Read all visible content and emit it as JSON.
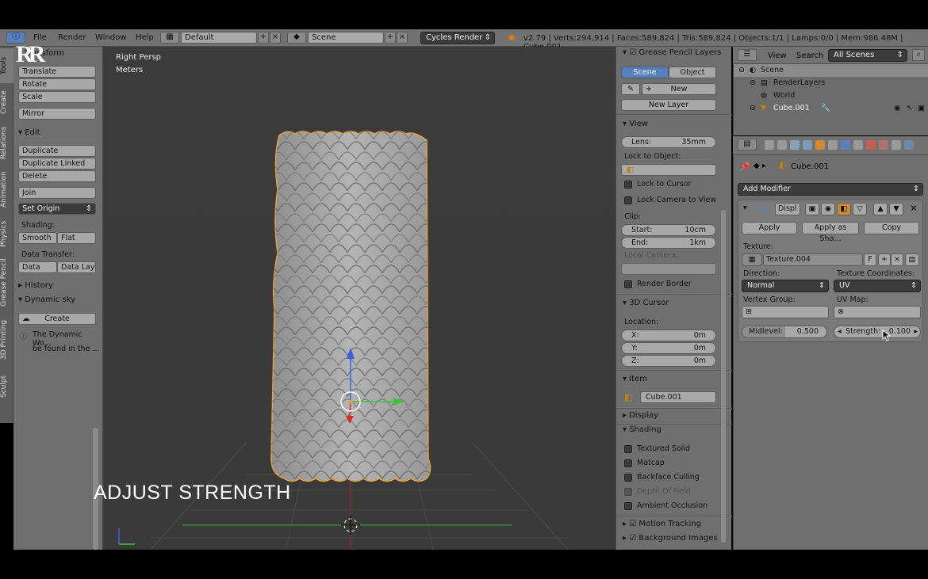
{
  "header": {
    "menus": [
      "File",
      "Render",
      "Window",
      "Help"
    ],
    "layout_name": "Default",
    "scene_name": "Scene",
    "render_engine": "Cycles Render",
    "stats": "v2.79 | Verts:294,914 | Faces:589,824 | Tris:589,824 | Objects:1/1 | Lamps:0/0 | Mem:986.48M | Cube.001"
  },
  "vtabs": [
    "Tools",
    "Create",
    "Relations",
    "Animation",
    "Physics",
    "Grease Pencil",
    "3D Printing",
    "Sculpt"
  ],
  "toolshelf": {
    "transform": {
      "title": "Transform",
      "buttons": [
        "Translate",
        "Rotate",
        "Scale",
        "Mirror"
      ]
    },
    "edit": {
      "title": "Edit",
      "buttons": [
        "Duplicate",
        "Duplicate Linked",
        "Delete",
        "Join"
      ],
      "set_origin": "Set Origin",
      "shading_label": "Shading:",
      "smooth": "Smooth",
      "flat": "Flat",
      "data_transfer_label": "Data Transfer:",
      "data": "Data",
      "data_lay": "Data Lay"
    },
    "history": "History",
    "dynamic_sky": {
      "title": "Dynamic sky",
      "create": "Create",
      "info1": "The Dynamic Wo...",
      "info2": "be found in the ..."
    }
  },
  "viewport": {
    "view_name": "Right Persp",
    "units": "Meters",
    "overlay_title": "ADJUST STRENGTH",
    "logo": "RR"
  },
  "npanel": {
    "grease_pencil": {
      "title": "Grease Pencil Layers",
      "scene": "Scene",
      "object": "Object",
      "new": "New",
      "new_layer": "New Layer"
    },
    "view": {
      "title": "View",
      "lens_label": "Lens:",
      "lens_value": "35mm",
      "lock_to_object": "Lock to Object:",
      "lock_to_cursor": "Lock to Cursor",
      "lock_camera": "Lock Camera to View",
      "clip_label": "Clip:",
      "start_label": "Start:",
      "start_value": "10cm",
      "end_label": "End:",
      "end_value": "1km",
      "local_camera": "Local Camera:",
      "render_border": "Render Border"
    },
    "cursor": {
      "title": "3D Cursor",
      "location": "Location:",
      "x_label": "X:",
      "x_value": "0m",
      "y_label": "Y:",
      "y_value": "0m",
      "z_label": "Z:",
      "z_value": "0m"
    },
    "item": {
      "title": "Item",
      "name": "Cube.001"
    },
    "display": "Display",
    "shading": {
      "title": "Shading",
      "options": [
        "Textured Solid",
        "Matcap",
        "Backface Culling",
        "Depth Of Field",
        "Ambient Occlusion"
      ]
    },
    "motion_tracking": "Motion Tracking",
    "background_images": "Background Images"
  },
  "outliner": {
    "view": "View",
    "search": "Search",
    "filter": "All Scenes",
    "rows": [
      "Scene",
      "RenderLayers",
      "World",
      "Cube.001"
    ]
  },
  "properties": {
    "breadcrumb": "Cube.001",
    "add_modifier": "Add Modifier",
    "modifier_name": "Displ",
    "apply": "Apply",
    "apply_as_shape": "Apply as Sha...",
    "copy": "Copy",
    "texture_label": "Texture:",
    "texture_name": "Texture.004",
    "texture_fake": "F",
    "direction_label": "Direction:",
    "direction_value": "Normal",
    "coords_label": "Texture Coordinates:",
    "coords_value": "UV",
    "vertex_group_label": "Vertex Group:",
    "uv_map_label": "UV Map:",
    "midlevel_label": "Midlevel:",
    "midlevel_value": "0.500",
    "strength_label": "Strength:",
    "strength_value": "0.100"
  },
  "colors": {
    "accent_blue": "#5680c2",
    "selection_orange": "#e8a23a",
    "viewport_bg": "#3b3b3b"
  }
}
